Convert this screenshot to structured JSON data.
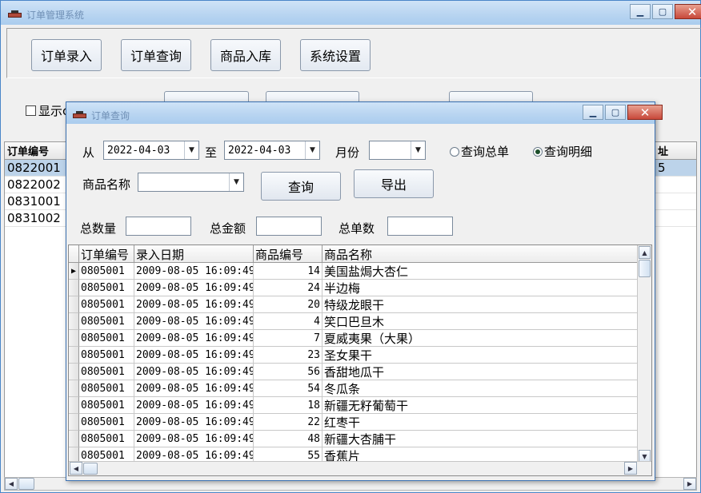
{
  "window": {
    "title": "订单管理系统",
    "minimize_glyph": "▁",
    "maximize_glyph": "▢",
    "close_glyph": "✕"
  },
  "toolbar": {
    "buttons": [
      {
        "label": "订单录入"
      },
      {
        "label": "订单查询"
      },
      {
        "label": "商品入库"
      },
      {
        "label": "系统设置"
      }
    ]
  },
  "background": {
    "checkbox_label": "显示c",
    "grid_header_id": "订单编号",
    "grid_header_right": "址",
    "right_cell_value": "5",
    "rows": [
      "0822001",
      "0822002",
      "0831001",
      "0831002"
    ]
  },
  "dialog": {
    "title": "订单查询",
    "from_label": "从",
    "from_date": "2022-04-03",
    "to_label": "至",
    "to_date": "2022-04-03",
    "month_label": "月份",
    "month_value": "",
    "radio_summary_label": "查询总单",
    "radio_detail_label": "查询明细",
    "product_name_label": "商品名称",
    "product_name_value": "",
    "query_button": "查询",
    "export_button": "导出",
    "total_qty_label": "总数量",
    "total_amount_label": "总金额",
    "total_orders_label": "总单数",
    "total_qty_value": "",
    "total_amount_value": "",
    "total_orders_value": ""
  },
  "icons": {
    "dropdown_arrow": "▼",
    "row_indicator": "▶",
    "scroll_up": "▲",
    "scroll_down": "▼",
    "scroll_left": "◀",
    "scroll_right": "▶"
  },
  "grid": {
    "columns": [
      "订单编号",
      "录入日期",
      "商品编号",
      "商品名称"
    ],
    "rows": [
      {
        "id": "0805001",
        "date": "2009-08-05 16:09:49",
        "code": "14",
        "name": "美国盐焗大杏仁"
      },
      {
        "id": "0805001",
        "date": "2009-08-05 16:09:49",
        "code": "24",
        "name": "半边梅"
      },
      {
        "id": "0805001",
        "date": "2009-08-05 16:09:49",
        "code": "20",
        "name": "特级龙眼干"
      },
      {
        "id": "0805001",
        "date": "2009-08-05 16:09:49",
        "code": "4",
        "name": "笑口巴旦木"
      },
      {
        "id": "0805001",
        "date": "2009-08-05 16:09:49",
        "code": "7",
        "name": "夏威夷果（大果）"
      },
      {
        "id": "0805001",
        "date": "2009-08-05 16:09:49",
        "code": "23",
        "name": "圣女果干"
      },
      {
        "id": "0805001",
        "date": "2009-08-05 16:09:49",
        "code": "56",
        "name": "香甜地瓜干"
      },
      {
        "id": "0805001",
        "date": "2009-08-05 16:09:49",
        "code": "54",
        "name": "冬瓜条"
      },
      {
        "id": "0805001",
        "date": "2009-08-05 16:09:49",
        "code": "18",
        "name": "新疆无籽葡萄干"
      },
      {
        "id": "0805001",
        "date": "2009-08-05 16:09:49",
        "code": "22",
        "name": "红枣干"
      },
      {
        "id": "0805001",
        "date": "2009-08-05 16:09:49",
        "code": "48",
        "name": "新疆大杏脯干"
      },
      {
        "id": "0805001",
        "date": "2009-08-05 16:09:49",
        "code": "55",
        "name": "香蕉片"
      }
    ]
  }
}
